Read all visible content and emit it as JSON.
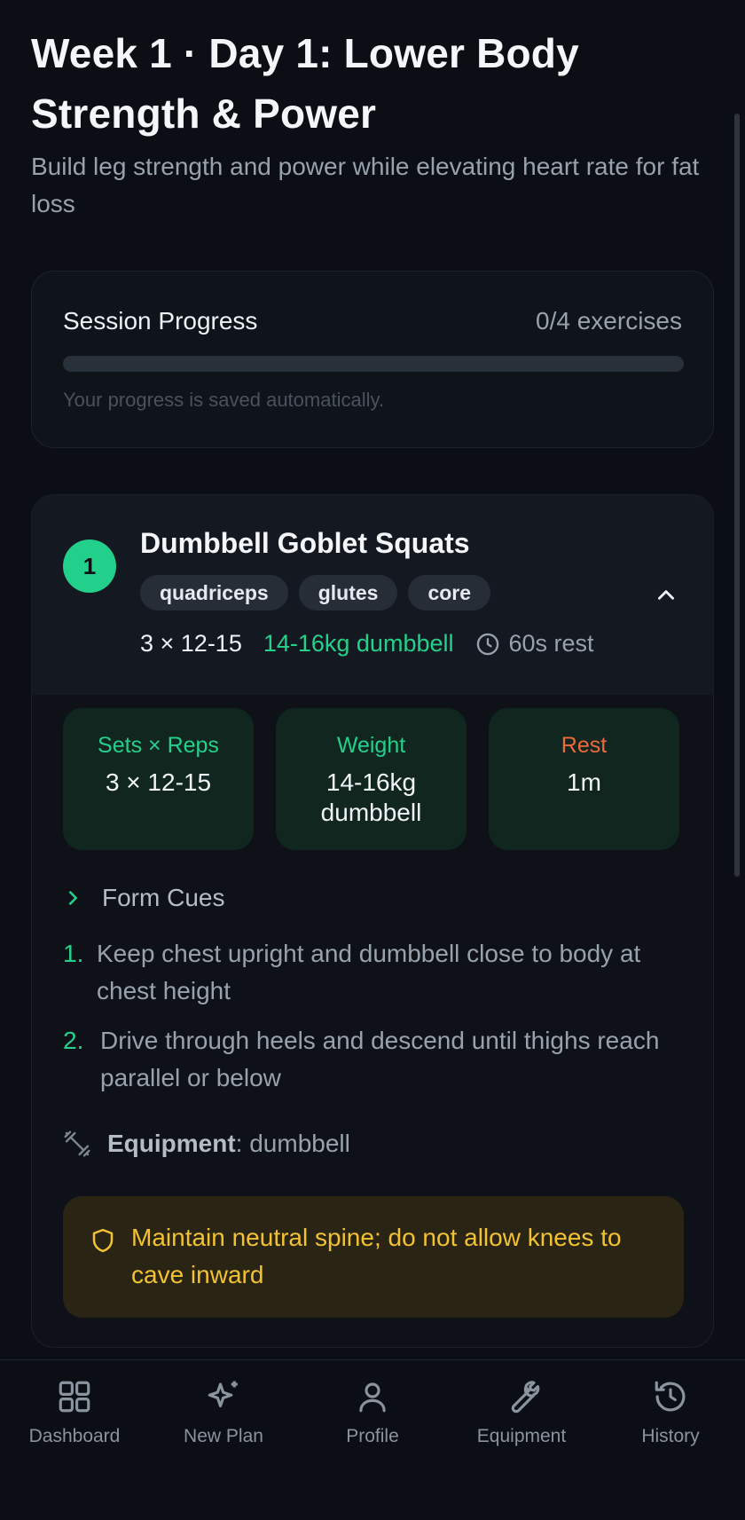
{
  "header": {
    "title": "Week 1 · Day 1: Lower Body Strength & Power",
    "subtitle": "Build leg strength and power while elevating heart rate for fat loss"
  },
  "progress": {
    "label": "Session Progress",
    "count": "0/4 exercises",
    "completed": 0,
    "total": 4,
    "note": "Your progress is saved automatically."
  },
  "exercise": {
    "number": "1",
    "name": "Dumbbell Goblet Squats",
    "tags": [
      "quadriceps",
      "glutes",
      "core"
    ],
    "meta": {
      "sets": "3 × 12-15",
      "weight": "14-16kg dumbbell",
      "rest": "60s rest"
    },
    "stats": [
      {
        "label": "Sets × Reps",
        "value": "3 × 12-15"
      },
      {
        "label": "Weight",
        "value": "14-16kg dumbbell"
      },
      {
        "label": "Rest",
        "value": "1m"
      }
    ],
    "form_cues_label": "Form Cues",
    "cues": [
      {
        "num": "1.",
        "text": "Keep chest upright and dumbbell close to body at chest height"
      },
      {
        "num": "2.",
        "text": "Drive through heels and descend until thighs reach parallel or below"
      }
    ],
    "equipment_label": "Equipment",
    "equipment_value": ": dumbbell",
    "warning": "Maintain neutral spine; do not allow knees to cave inward"
  },
  "nav": {
    "items": [
      {
        "label": "Dashboard",
        "icon": "dashboard-icon"
      },
      {
        "label": "New Plan",
        "icon": "sparkles-icon"
      },
      {
        "label": "Profile",
        "icon": "user-icon"
      },
      {
        "label": "Equipment",
        "icon": "wrench-icon"
      },
      {
        "label": "History",
        "icon": "history-icon"
      }
    ]
  },
  "colors": {
    "accent": "#23d18b",
    "rest": "#ec6a3a",
    "warning": "#f2c230",
    "background": "#0b0e14"
  }
}
